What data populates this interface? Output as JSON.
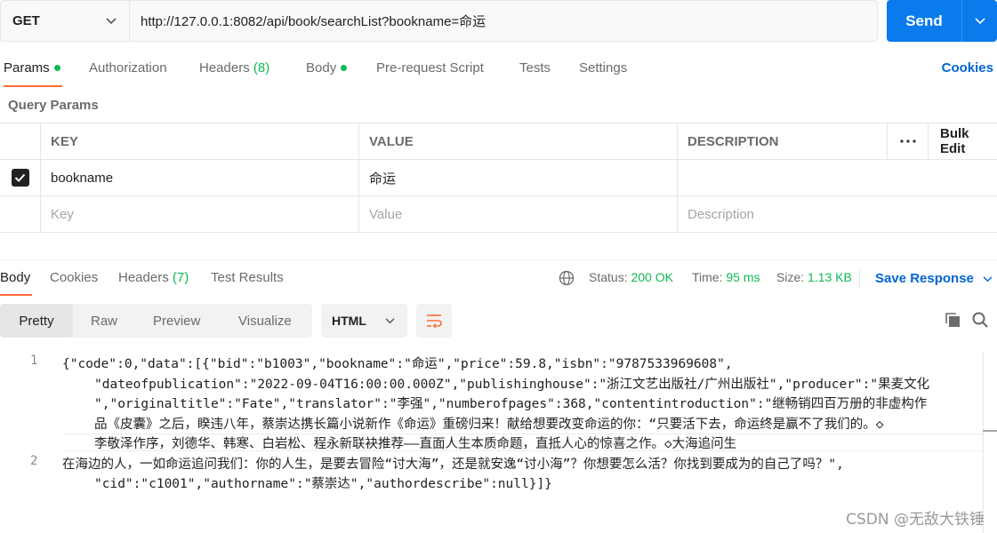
{
  "request": {
    "method": "GET",
    "url": "http://127.0.0.1:8082/api/book/searchList?bookname=命运",
    "send_label": "Send"
  },
  "request_tabs": {
    "params": "Params",
    "authorization": "Authorization",
    "headers": "Headers",
    "headers_count": "(8)",
    "body": "Body",
    "prerequest": "Pre-request Script",
    "tests": "Tests",
    "settings": "Settings",
    "cookies": "Cookies"
  },
  "query_params": {
    "title": "Query Params",
    "columns": {
      "key": "KEY",
      "value": "VALUE",
      "description": "DESCRIPTION",
      "bulk_edit": "Bulk Edit"
    },
    "rows": [
      {
        "key": "bookname",
        "value": "命运",
        "description": "",
        "checked": true
      }
    ],
    "placeholders": {
      "key": "Key",
      "value": "Value",
      "description": "Description"
    }
  },
  "response_tabs": {
    "body": "Body",
    "cookies": "Cookies",
    "headers": "Headers",
    "headers_count": "(7)",
    "test_results": "Test Results"
  },
  "status": {
    "status_label": "Status:",
    "status_value": "200 OK",
    "time_label": "Time:",
    "time_value": "95 ms",
    "size_label": "Size:",
    "size_value": "1.13 KB",
    "save_response": "Save Response"
  },
  "view_modes": {
    "pretty": "Pretty",
    "raw": "Raw",
    "preview": "Preview",
    "visualize": "Visualize",
    "format": "HTML"
  },
  "code": {
    "line_numbers": [
      "1",
      "2"
    ],
    "lines": [
      "{\"code\":0,\"data\":[{\"bid\":\"b1003\",\"bookname\":\"命运\",\"price\":59.8,\"isbn\":\"9787533969608\",",
      "\"dateofpublication\":\"2022-09-04T16:00:00.000Z\",\"publishinghouse\":\"浙江文艺出版社/广州出版社\",\"producer\":\"果麦文化",
      "\",\"originaltitle\":\"Fate\",\"translator\":\"李强\",\"numberofpages\":368,\"contentintroduction\":\"继畅销四百万册的非虚构作",
      "品《皮囊》之后，睽违八年，蔡崇达携长篇小说新作《命运》重磅归来！献给想要改变命运的你：“只要活下去，命运终是赢不了我们的。◇",
      "李敬泽作序，刘德华、韩寒、白岩松、程永新联袂推荐——直面人生本质命题，直抵人心的惊喜之作。◇大海追问生",
      "在海边的人，一如命运追问我们：你的人生，是要去冒险“讨大海”，还是就安逸“讨小海”？你想要怎么活？你找到要成为的自己了吗？\",",
      "\"cid\":\"c1001\",\"authorname\":\"蔡崇达\",\"authordescribe\":null}]}"
    ]
  },
  "watermark": "CSDN @无敌大铁锤"
}
